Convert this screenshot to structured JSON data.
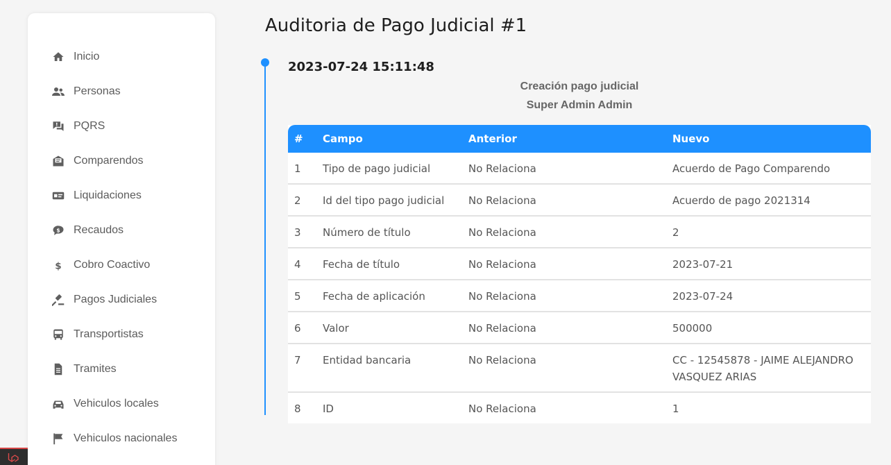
{
  "sidebar": {
    "items": [
      {
        "label": "Inicio",
        "icon": "home-icon"
      },
      {
        "label": "Personas",
        "icon": "users-icon"
      },
      {
        "label": "PQRS",
        "icon": "question-chat-icon"
      },
      {
        "label": "Comparendos",
        "icon": "envelope-open-icon"
      },
      {
        "label": "Liquidaciones",
        "icon": "money-bill-icon"
      },
      {
        "label": "Recaudos",
        "icon": "comment-dollar-icon"
      },
      {
        "label": "Cobro Coactivo",
        "icon": "dollar-icon"
      },
      {
        "label": "Pagos Judiciales",
        "icon": "gavel-icon"
      },
      {
        "label": "Transportistas",
        "icon": "bus-icon"
      },
      {
        "label": "Tramites",
        "icon": "file-icon"
      },
      {
        "label": "Vehiculos locales",
        "icon": "car-icon"
      },
      {
        "label": "Vehiculos nacionales",
        "icon": "flag-icon"
      }
    ]
  },
  "page": {
    "title": "Auditoria de Pago Judicial #1"
  },
  "entry": {
    "datetime": "2023-07-24 15:11:48",
    "action": "Creación pago judicial",
    "user": "Super Admin Admin"
  },
  "table": {
    "headers": [
      "#",
      "Campo",
      "Anterior",
      "Nuevo"
    ],
    "rows": [
      {
        "n": "1",
        "campo": "Tipo de pago judicial",
        "anterior": "No Relaciona",
        "nuevo": "Acuerdo de Pago Comparendo"
      },
      {
        "n": "2",
        "campo": "Id del tipo pago judicial",
        "anterior": "No Relaciona",
        "nuevo": "Acuerdo de pago 2021314"
      },
      {
        "n": "3",
        "campo": "Número de título",
        "anterior": "No Relaciona",
        "nuevo": "2"
      },
      {
        "n": "4",
        "campo": "Fecha de título",
        "anterior": "No Relaciona",
        "nuevo": "2023-07-21"
      },
      {
        "n": "5",
        "campo": "Fecha de aplicación",
        "anterior": "No Relaciona",
        "nuevo": "2023-07-24"
      },
      {
        "n": "6",
        "campo": "Valor",
        "anterior": "No Relaciona",
        "nuevo": "500000"
      },
      {
        "n": "7",
        "campo": "Entidad bancaria",
        "anterior": "No Relaciona",
        "nuevo": "CC - 12545878 - JAIME ALEJANDRO VASQUEZ ARIAS"
      },
      {
        "n": "8",
        "campo": "ID",
        "anterior": "No Relaciona",
        "nuevo": "1"
      }
    ]
  },
  "colors": {
    "accent": "#1e90ff",
    "background": "#f5f5f5"
  }
}
